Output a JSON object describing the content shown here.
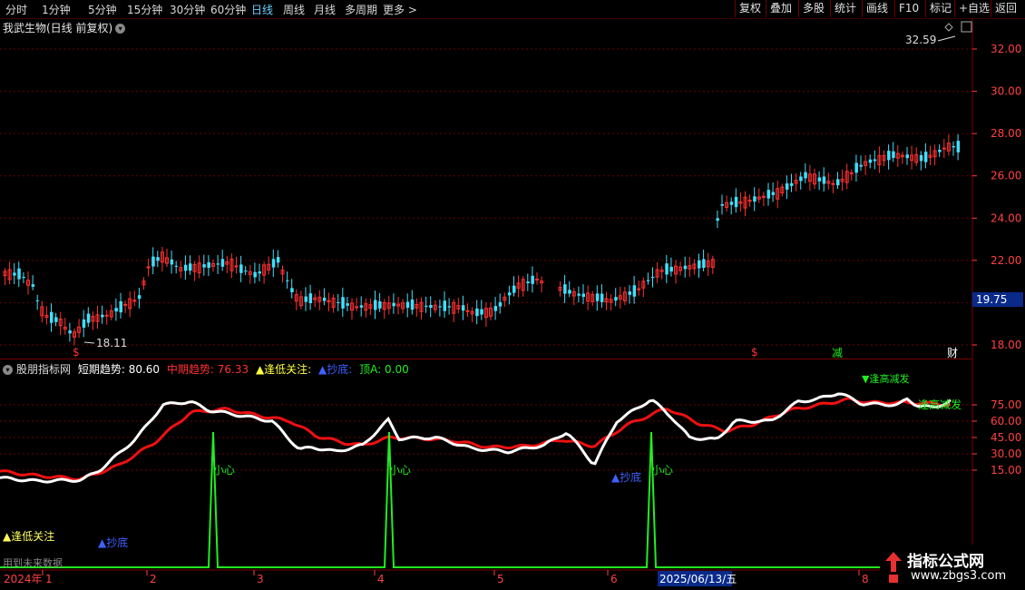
{
  "toolbar": {
    "timeframes": [
      "分时",
      "1分钟",
      "5分钟",
      "15分钟",
      "30分钟",
      "60分钟",
      "日线",
      "周线",
      "月线",
      "多周期",
      "更多 >"
    ],
    "active_timeframe": "日线",
    "right_buttons": [
      "复权",
      "叠加",
      "多股",
      "统计",
      "画线",
      "F10",
      "+自选",
      "返回"
    ],
    "mark_button": "标记"
  },
  "stock": {
    "title": "我武生物(日线 前复权)",
    "current_price_flag": "19.75",
    "high_label": "32.59",
    "low_label": "18.11"
  },
  "price_axis": [
    "32.00",
    "30.00",
    "28.00",
    "26.00",
    "24.00",
    "22.00",
    "20.00",
    "18.00"
  ],
  "markers": {
    "s1": "$",
    "s2": "$",
    "jian": "减",
    "cai": "财"
  },
  "indicator": {
    "name": "股朋指标网",
    "short_label": "短期趋势: 80.60",
    "mid_label": "中期趋势: 76.33",
    "low_focus_label": "▲逢低关注:",
    "bottom_label": "▲抄底:",
    "top_label": "顶A: 0.00",
    "axis": [
      "75.00",
      "60.00",
      "45.00",
      "30.00",
      "15.00"
    ],
    "annotations": {
      "careful": "小心",
      "dip": "▲抄底",
      "low_focus": "▲逢低关注",
      "future_data": "用到未来数据",
      "high_warn": "▼逢高减发",
      "right_note": "逢高减发"
    }
  },
  "date_axis": {
    "labels": [
      "2024年",
      "1",
      "2",
      "3",
      "4",
      "5",
      "6",
      "2025/06/13/五",
      "8"
    ]
  },
  "watermark": {
    "title": "指标公式网",
    "url": "www.zbgs3.com"
  },
  "colors": {
    "up": "#ff3030",
    "down": "#40e0ff",
    "short": "#ffffff",
    "mid": "#ee1010",
    "top": "#20ee20",
    "grid": "#6a0000"
  }
}
